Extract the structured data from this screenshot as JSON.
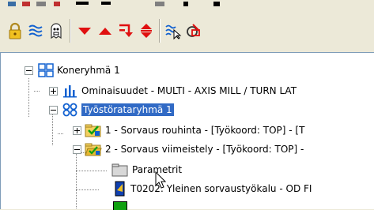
{
  "toolbar": {
    "icons": [
      "lock-icon",
      "wave-icon",
      "ghost-icon",
      "down-arrow-icon",
      "up-arrow-icon",
      "branch-arrow-icon",
      "up-down-arrow-icon",
      "wave-cursor-icon",
      "pencil-circle-icon"
    ]
  },
  "tree": {
    "root": {
      "label": "Koneryhmä 1"
    },
    "properties": {
      "label": "Ominaisuudet - MULTI - AXIS  MILL / TURN  LAT"
    },
    "toolpath_group": {
      "label": "Työstörataryhmä 1"
    },
    "op1": {
      "label": "1 - Sorvaus rouhinta - [Työkoord: TOP] - [T"
    },
    "op2": {
      "label": "2 - Sorvaus viimeistely - [Työkoord: TOP] -"
    },
    "parameters": {
      "label": "Parametrit"
    },
    "tool": {
      "label": "T0202: Yleinen sorvaustyökalu - OD FI"
    }
  },
  "colors": {
    "selection": "#316ac5",
    "accent_red": "#e01010",
    "accent_blue": "#1060d0"
  }
}
